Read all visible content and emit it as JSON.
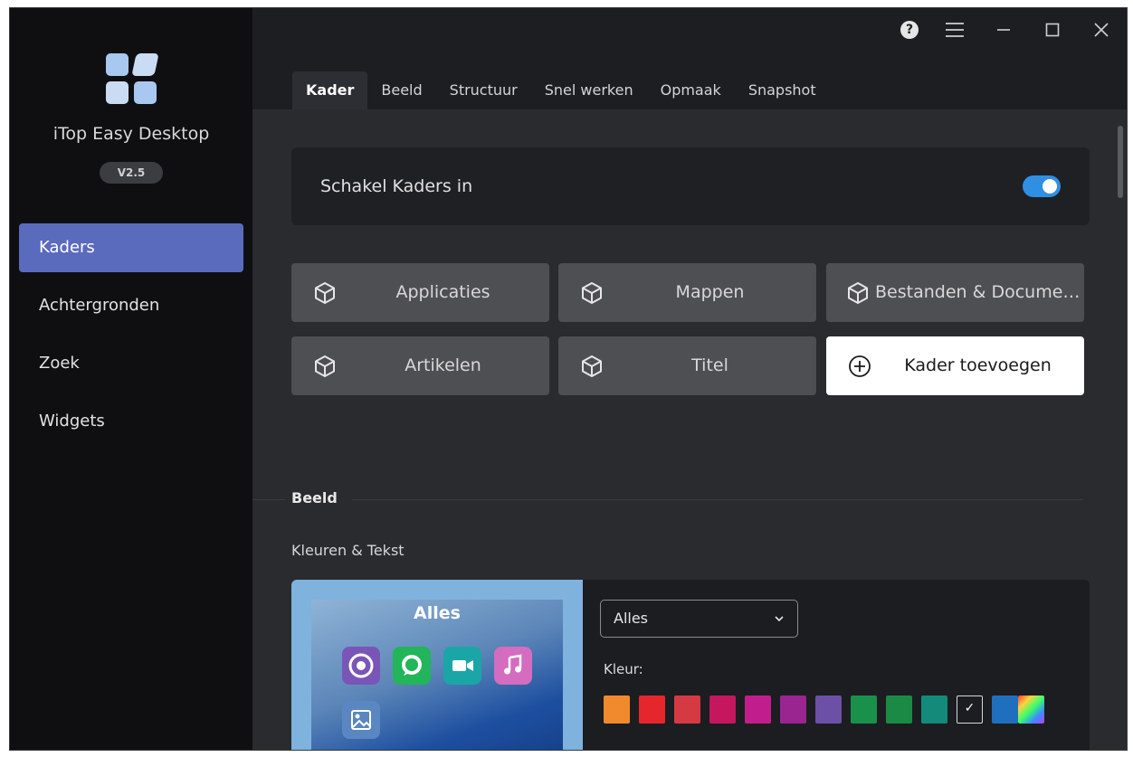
{
  "app": {
    "name": "iTop Easy Desktop",
    "version": "V2.5"
  },
  "sidebar": {
    "items": [
      {
        "label": "Kaders",
        "active": true
      },
      {
        "label": "Achtergronden",
        "active": false
      },
      {
        "label": "Zoek",
        "active": false
      },
      {
        "label": "Widgets",
        "active": false
      }
    ]
  },
  "titlebar": {
    "help": "?",
    "icons": [
      "help-icon",
      "menu-icon",
      "minimize-icon",
      "maximize-icon",
      "close-icon"
    ]
  },
  "tabs": [
    {
      "label": "Kader",
      "active": true
    },
    {
      "label": "Beeld",
      "active": false
    },
    {
      "label": "Structuur",
      "active": false
    },
    {
      "label": "Snel werken",
      "active": false
    },
    {
      "label": "Opmaak",
      "active": false
    },
    {
      "label": "Snapshot",
      "active": false
    }
  ],
  "toggle": {
    "label": "Schakel Kaders in",
    "on": true
  },
  "frames": [
    {
      "label": "Applicaties",
      "icon": "cube-icon"
    },
    {
      "label": "Mappen",
      "icon": "cube-icon"
    },
    {
      "label": "Bestanden & Documen...",
      "icon": "cube-icon"
    },
    {
      "label": "Artikelen",
      "icon": "cube-icon"
    },
    {
      "label": "Titel",
      "icon": "cube-icon"
    },
    {
      "label": "Kader toevoegen",
      "icon": "plus-circle-icon"
    }
  ],
  "section": {
    "title": "Beeld",
    "subtitle": "Kleuren & Tekst"
  },
  "preview": {
    "title": "Alles",
    "icons": [
      "chrome-icon",
      "whatsapp-icon",
      "video-icon",
      "music-icon",
      "image-icon"
    ]
  },
  "appearance": {
    "select_value": "Alles",
    "color_label": "Kleur:",
    "colors": [
      "#f08a2c",
      "#e6262d",
      "#d53a43",
      "#c4175e",
      "#c21d8c",
      "#9a2591",
      "#6c4fa6",
      "#19914a",
      "#1a8a45",
      "#138a7a",
      "#1c1d21",
      "#1f6fbd",
      "gradient"
    ],
    "selected_color_index": 10
  }
}
